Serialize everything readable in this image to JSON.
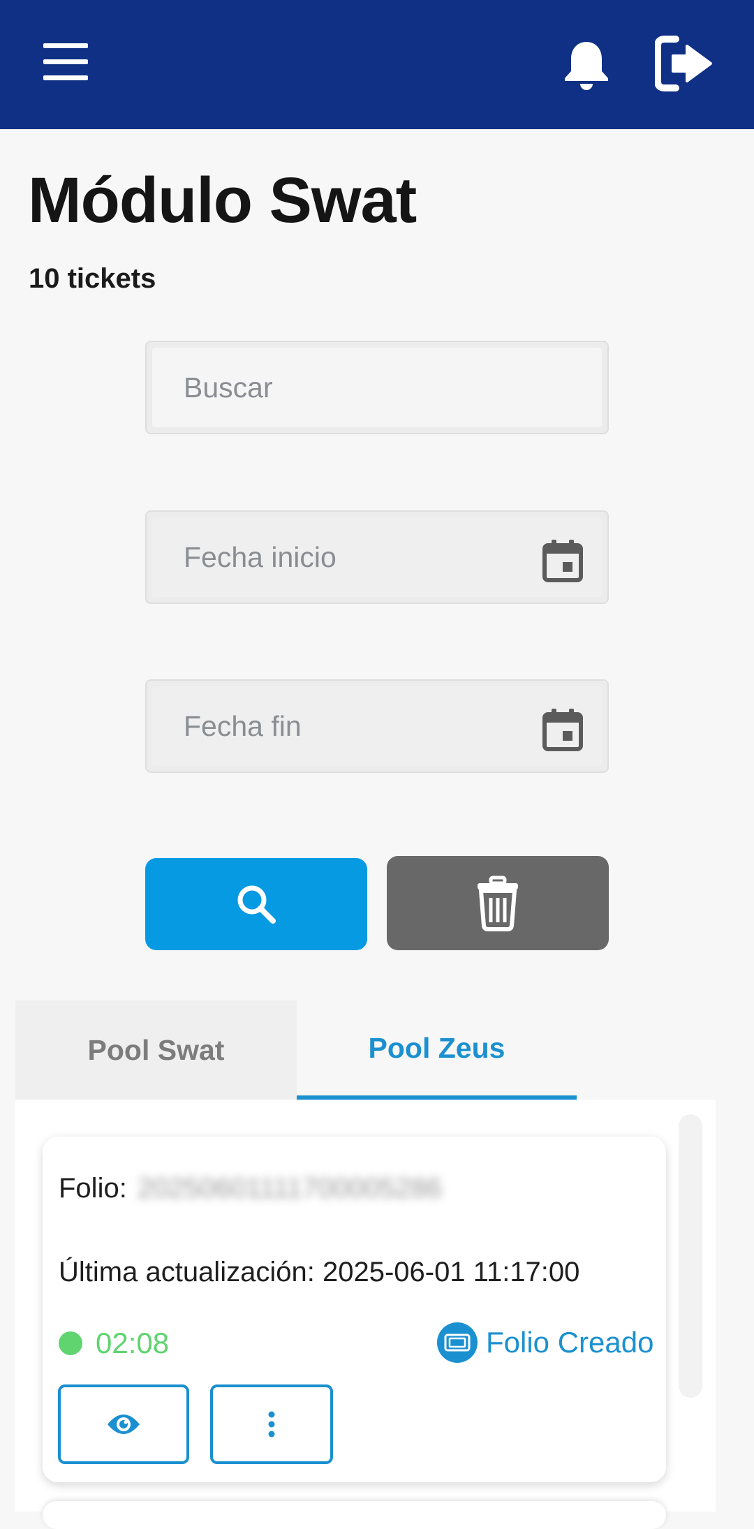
{
  "header": {
    "bg_color": "#0f3085",
    "menu_icon": "hamburger-menu-icon",
    "notification_icon": "bell-icon",
    "logout_icon": "sign-out-icon"
  },
  "page": {
    "title": "Módulo Swat",
    "ticket_count": "10 tickets"
  },
  "filters": {
    "search_placeholder": "Buscar",
    "start_date_placeholder": "Fecha inicio",
    "end_date_placeholder": "Fecha fin",
    "search_button_color": "#069ae2",
    "clear_button_color": "#686868"
  },
  "tabs": [
    {
      "label": "Pool Swat",
      "active": false
    },
    {
      "label": "Pool Zeus",
      "active": true
    }
  ],
  "tickets": [
    {
      "folio_label": "Folio:",
      "folio_value": "20250601111700005286",
      "updated_label": "Última actualización:",
      "updated_value": "2025-06-01 11:17:00",
      "timer": "02:08",
      "timer_color": "#5fd46f",
      "status": "Folio Creado",
      "status_color": "#1b90d0"
    }
  ]
}
